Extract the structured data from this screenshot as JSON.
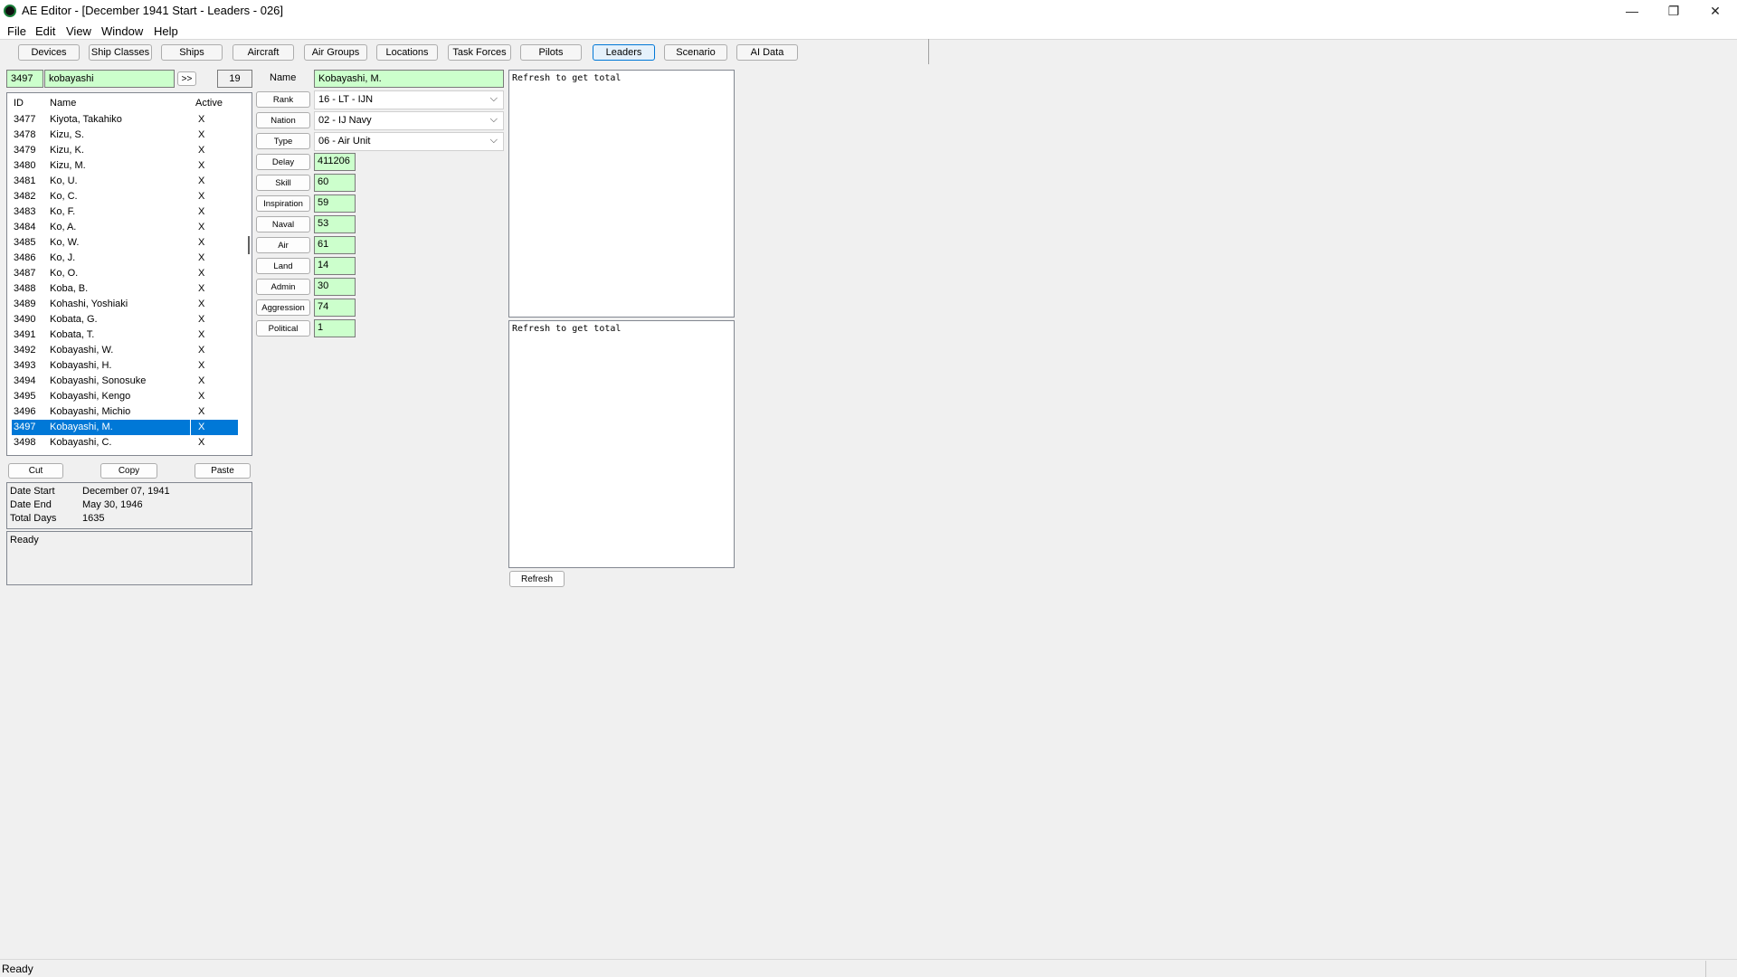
{
  "window": {
    "title": "AE Editor - [December 1941 Start - Leaders - 026]",
    "minimize": "—",
    "maximize": "❐",
    "close": "✕"
  },
  "menu": [
    "File",
    "Edit",
    "View",
    "Window",
    "Help"
  ],
  "tabs": [
    "Devices",
    "Ship Classes",
    "Ships",
    "Aircraft",
    "Air Groups",
    "Locations",
    "Task Forces",
    "Pilots",
    "Leaders",
    "Scenario",
    "AI Data"
  ],
  "active_tab": "Leaders",
  "search": {
    "id_value": "3497",
    "query": "kobayashi",
    "go_label": ">>",
    "count": "19"
  },
  "list": {
    "headers": {
      "id": "ID",
      "name": "Name",
      "active": "Active"
    },
    "rows": [
      {
        "id": "3477",
        "name": "Kiyota, Takahiko",
        "active": "X"
      },
      {
        "id": "3478",
        "name": "Kizu, S.",
        "active": "X"
      },
      {
        "id": "3479",
        "name": "Kizu, K.",
        "active": "X"
      },
      {
        "id": "3480",
        "name": "Kizu, M.",
        "active": "X"
      },
      {
        "id": "3481",
        "name": "Ko, U.",
        "active": "X"
      },
      {
        "id": "3482",
        "name": "Ko, C.",
        "active": "X"
      },
      {
        "id": "3483",
        "name": "Ko, F.",
        "active": "X"
      },
      {
        "id": "3484",
        "name": "Ko, A.",
        "active": "X"
      },
      {
        "id": "3485",
        "name": "Ko, W.",
        "active": "X"
      },
      {
        "id": "3486",
        "name": "Ko, J.",
        "active": "X"
      },
      {
        "id": "3487",
        "name": "Ko, O.",
        "active": "X"
      },
      {
        "id": "3488",
        "name": "Koba, B.",
        "active": "X"
      },
      {
        "id": "3489",
        "name": "Kohashi, Yoshiaki",
        "active": "X"
      },
      {
        "id": "3490",
        "name": "Kobata, G.",
        "active": "X"
      },
      {
        "id": "3491",
        "name": "Kobata, T.",
        "active": "X"
      },
      {
        "id": "3492",
        "name": "Kobayashi, W.",
        "active": "X"
      },
      {
        "id": "3493",
        "name": "Kobayashi, H.",
        "active": "X"
      },
      {
        "id": "3494",
        "name": "Kobayashi, Sonosuke",
        "active": "X"
      },
      {
        "id": "3495",
        "name": "Kobayashi, Kengo",
        "active": "X"
      },
      {
        "id": "3496",
        "name": "Kobayashi, Michio",
        "active": "X"
      },
      {
        "id": "3497",
        "name": "Kobayashi, M.",
        "active": "X"
      },
      {
        "id": "3498",
        "name": "Kobayashi, C.",
        "active": "X"
      }
    ],
    "selected_index": 20
  },
  "clipboard": {
    "cut": "Cut",
    "copy": "Copy",
    "paste": "Paste"
  },
  "dates": {
    "start_label": "Date Start",
    "start_value": "December 07, 1941",
    "end_label": "Date End",
    "end_value": "May 30, 1946",
    "days_label": "Total Days",
    "days_value": "1635"
  },
  "log": {
    "text": "Ready"
  },
  "form": {
    "name_label": "Name",
    "name_value": "Kobayashi, M.",
    "rank_label": "Rank",
    "rank_value": "16 - LT - IJN",
    "nation_label": "Nation",
    "nation_value": "02 - IJ Navy",
    "type_label": "Type",
    "type_value": "06 - Air Unit",
    "stats": [
      {
        "label": "Delay",
        "value": "411206"
      },
      {
        "label": "Skill",
        "value": "60"
      },
      {
        "label": "Inspiration",
        "value": "59"
      },
      {
        "label": "Naval",
        "value": "53"
      },
      {
        "label": "Air",
        "value": "61"
      },
      {
        "label": "Land",
        "value": "14"
      },
      {
        "label": "Admin",
        "value": "30"
      },
      {
        "label": "Aggression",
        "value": "74"
      },
      {
        "label": "Political",
        "value": "1"
      }
    ]
  },
  "totals": {
    "panel1": "Refresh to get total",
    "panel2": "Refresh to get total",
    "refresh_label": "Refresh"
  },
  "statusbar": {
    "text": "Ready"
  }
}
